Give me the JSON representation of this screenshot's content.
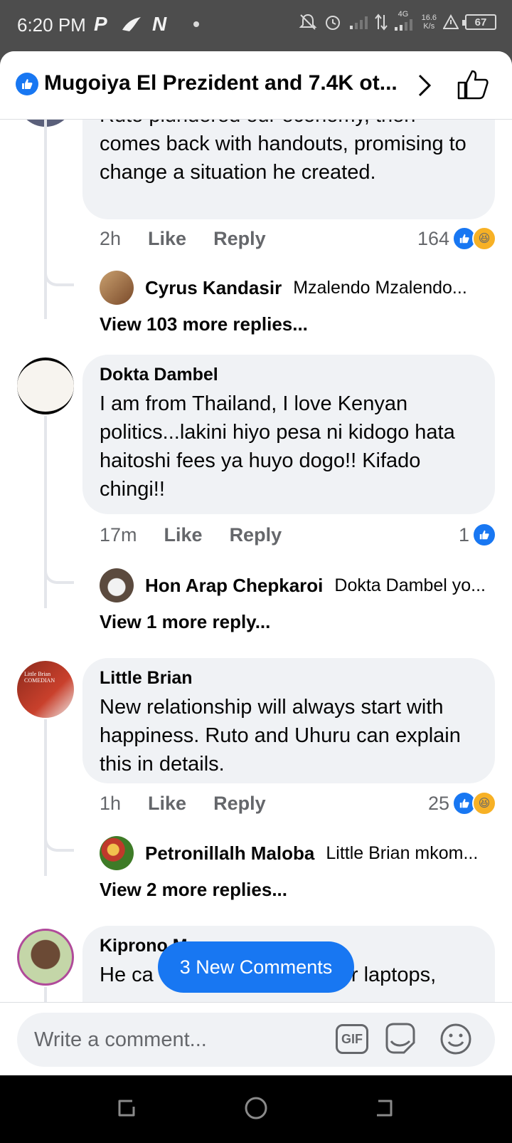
{
  "status_bar": {
    "time": "6:20 PM",
    "app_icons": [
      "P",
      "N"
    ],
    "network": "4G",
    "speed": "16.6",
    "speed_unit": "K/s",
    "battery": "67"
  },
  "header": {
    "title": "Mugoiya El Prezident and 7.4K ot...",
    "like_icon": "like-icon",
    "chevron_icon": "chevron-right-icon",
    "thumb_icon": "thumbs-up-icon"
  },
  "comments": [
    {
      "text_partial_top": "Ruto plundered our economy, then",
      "text": "comes back with handouts, promising to change a situation he created.",
      "time": "2h",
      "like_label": "Like",
      "reply_label": "Reply",
      "reactions": "164",
      "reply_preview": {
        "name": "Cyrus Kandasir",
        "text": "Mzalendo Mzalendo..."
      },
      "more_replies": "View 103 more replies..."
    },
    {
      "author": "Dokta Dambel",
      "text": "I am from Thailand, I love Kenyan politics...lakini hiyo pesa ni kidogo hata haitoshi fees ya huyo dogo!! Kifado chingi!!",
      "time": "17m",
      "like_label": "Like",
      "reply_label": "Reply",
      "reactions": "1",
      "reply_preview": {
        "name": "Hon Arap Chepkaroi",
        "text": "Dokta Dambel yo..."
      },
      "more_replies": "View 1 more reply..."
    },
    {
      "author": "Little Brian",
      "avatar_text": "Little Brian COMEDIAN",
      "text": "New relationship will always start with happiness. Ruto and Uhuru can explain this in details.",
      "time": "1h",
      "like_label": "Like",
      "reply_label": "Reply",
      "reactions": "25",
      "reply_preview": {
        "name": "Petronillalh Maloba",
        "text": "Little Brian mkom..."
      },
      "more_replies": "View 2 more replies..."
    },
    {
      "author": "Kiprono M",
      "text_line1": "He ca",
      "text_line1_end": "or laptops,"
    }
  ],
  "new_comments_button": "3 New Comments",
  "composer": {
    "placeholder": "Write a comment...",
    "gif_label": "GIF"
  },
  "colors": {
    "accent": "#1877f2",
    "bubble": "#f0f2f5",
    "secondary_text": "#65676b",
    "haha": "#f7b125"
  }
}
